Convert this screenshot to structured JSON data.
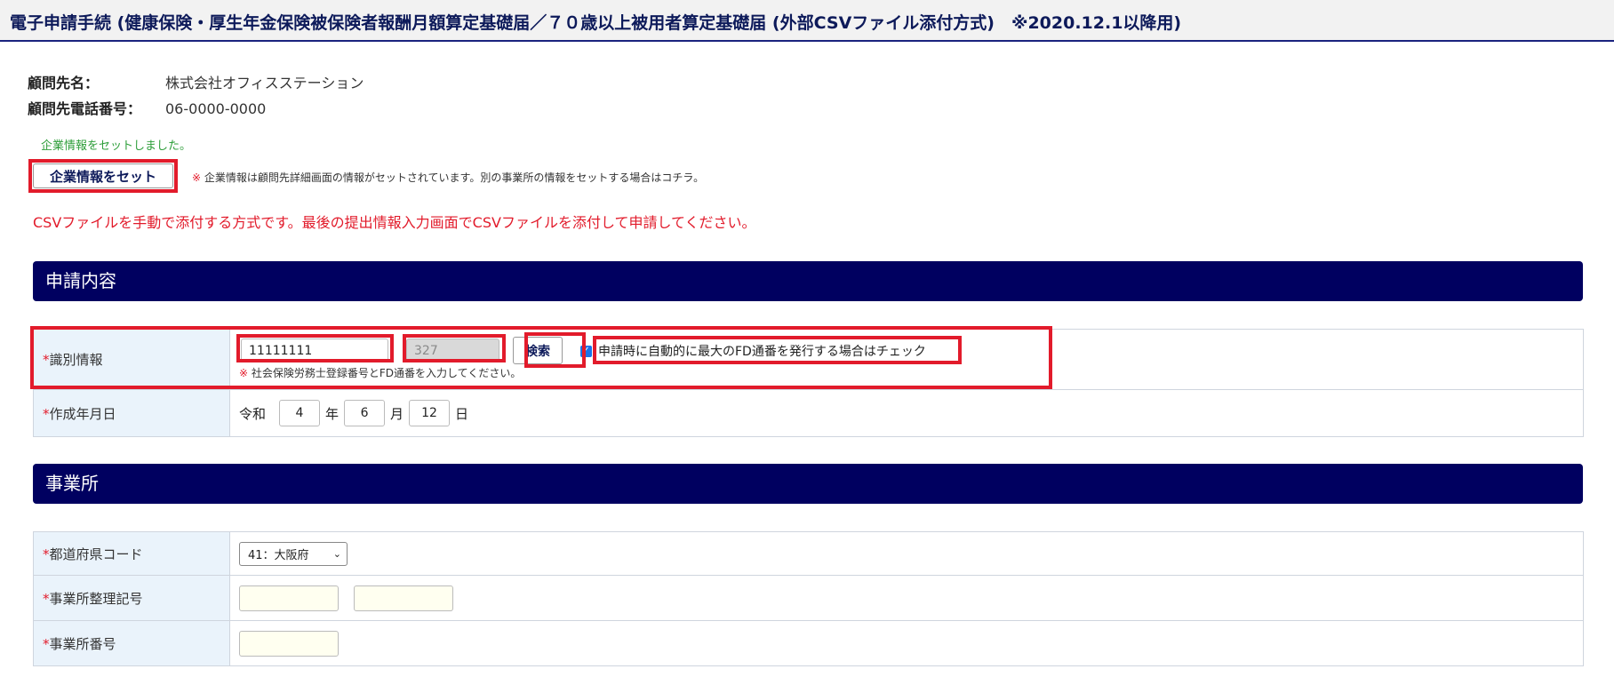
{
  "header": {
    "title": "電子申請手続 (健康保険・厚生年金保険被保険者報酬月額算定基礎届／７０歳以上被用者算定基礎届 (外部CSVファイル添付方式)　※2020.12.1以降用)"
  },
  "client": {
    "name_label": "顧問先名：",
    "name_value": "株式会社オフィスステーション",
    "phone_label": "顧問先電話番号：",
    "phone_value": "06-0000-0000"
  },
  "company_info": {
    "set_message": "企業情報をセットしました。",
    "set_button_label": "企業情報をセット",
    "note_mark": "※",
    "note_text": "企業情報は顧問先詳細画面の情報がセットされています。別の事業所の情報をセットする場合はコチラ。"
  },
  "csv_notice": "CSVファイルを手動で添付する方式です。最後の提出情報入力画面でCSVファイルを添付して申請してください。",
  "sections": {
    "application": {
      "title": "申請内容",
      "id_info": {
        "required_mark": "*",
        "label": "識別情報",
        "registration_number": "11111111",
        "fd_serial": "327",
        "search_button_label": "検索",
        "auto_fd_checked": true,
        "auto_fd_label": "申請時に自動的に最大のFD通番を発行する場合はチェック",
        "note_mark": "※",
        "note_text": "社会保険労務士登録番号とFD通番を入力してください。"
      },
      "created_date": {
        "required_mark": "*",
        "label": "作成年月日",
        "era": "令和",
        "year": "4",
        "year_unit": "年",
        "month": "6",
        "month_unit": "月",
        "day": "12",
        "day_unit": "日"
      }
    },
    "office": {
      "title": "事業所",
      "prefecture": {
        "required_mark": "*",
        "label": "都道府県コード",
        "selected": "41：大阪府"
      },
      "office_code": {
        "required_mark": "*",
        "label": "事業所整理記号",
        "value1": "",
        "value2": ""
      },
      "office_number": {
        "required_mark": "*",
        "label": "事業所番号",
        "value": ""
      }
    }
  },
  "colors": {
    "header_title": "#0d1a5a",
    "section_bar": "#000060",
    "highlight": "#e21b2b",
    "success": "#2e9e3a",
    "label_cell": "#eaf3fb"
  }
}
